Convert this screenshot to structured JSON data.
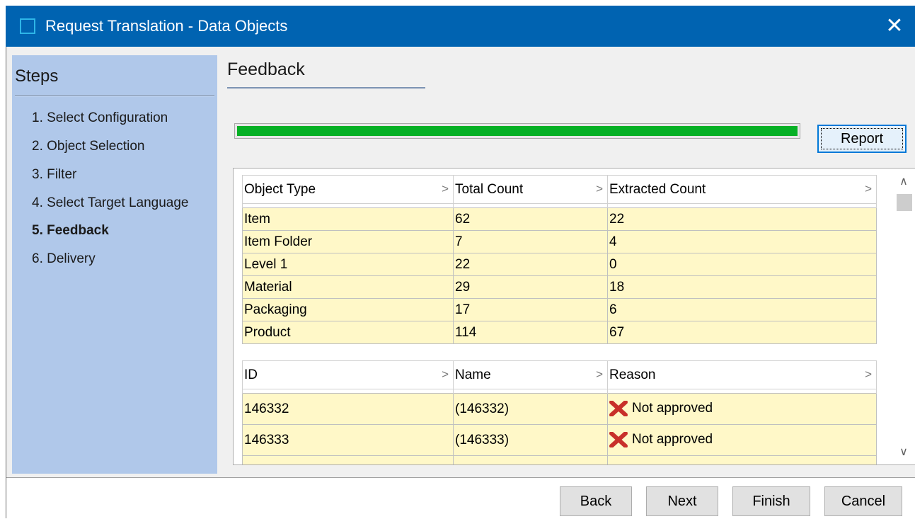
{
  "window": {
    "title": "Request Translation - Data Objects",
    "close_glyph": "✕"
  },
  "steps": {
    "header": "Steps",
    "items": [
      {
        "label": "1. Select Configuration",
        "active": false
      },
      {
        "label": "2. Object Selection",
        "active": false
      },
      {
        "label": "3. Filter",
        "active": false
      },
      {
        "label": "4. Select Target Language",
        "active": false
      },
      {
        "label": "5. Feedback",
        "active": true
      },
      {
        "label": "6. Delivery",
        "active": false
      }
    ]
  },
  "main": {
    "section_title": "Feedback",
    "progress_percent": 100,
    "progress_color": "#06b025",
    "report_button": "Report"
  },
  "summary_table": {
    "columns": [
      "Object Type",
      "Total Count",
      "Extracted Count"
    ],
    "rows": [
      [
        "Item",
        "62",
        "22"
      ],
      [
        "Item Folder",
        "7",
        "4"
      ],
      [
        "Level 1",
        "22",
        "0"
      ],
      [
        "Material",
        "29",
        "18"
      ],
      [
        "Packaging",
        "17",
        "6"
      ],
      [
        "Product",
        "114",
        "67"
      ]
    ]
  },
  "detail_table": {
    "columns": [
      "ID",
      "Name",
      "Reason"
    ],
    "rows": [
      {
        "id": "146332",
        "name": "(146332)",
        "reason": "Not approved",
        "icon": "red-x-icon"
      },
      {
        "id": "146333",
        "name": "(146333)",
        "reason": "Not approved",
        "icon": "red-x-icon"
      }
    ]
  },
  "buttons": {
    "back": "Back",
    "next": "Next",
    "finish": "Finish",
    "cancel": "Cancel"
  },
  "colors": {
    "titlebar": "#0063b1",
    "steps_panel": "#b0c8ea",
    "row_highlight": "#fff8c8"
  }
}
